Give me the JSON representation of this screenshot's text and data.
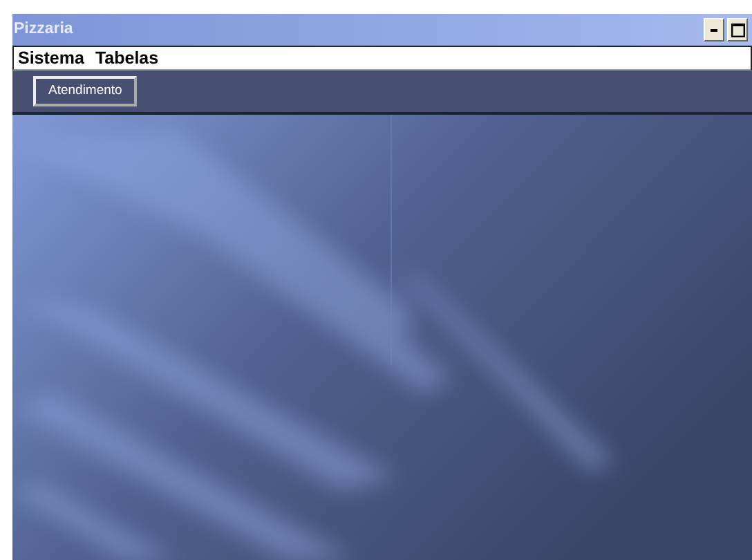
{
  "window": {
    "title": "Pizzaria"
  },
  "menu": [
    "Sistema",
    "Tabelas"
  ],
  "toolbar": {
    "buttons": [
      "Atendimento"
    ]
  }
}
